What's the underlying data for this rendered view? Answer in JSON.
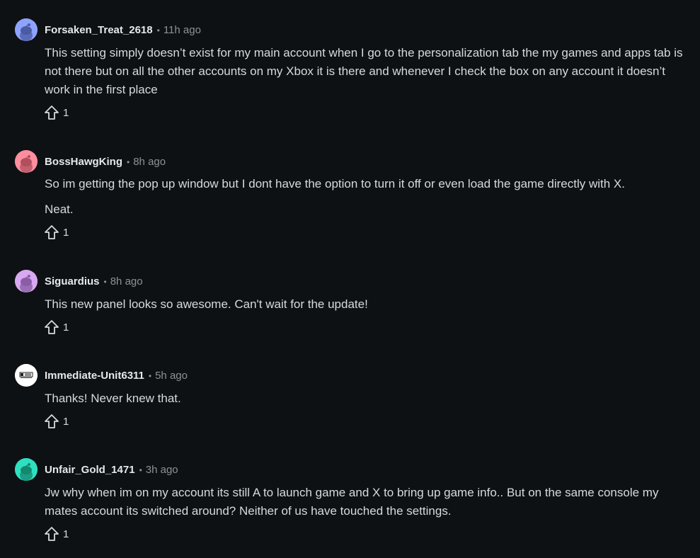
{
  "comments": [
    {
      "author": "Forsaken_Treat_2618",
      "time": "11h ago",
      "paragraphs": [
        "This setting simply doesn’t exist for my main account when I go to the personalization tab the my games and apps tab is not there but on all the other accounts on my Xbox it is there and whenever I check the box on any account it doesn’t work in the first place"
      ],
      "votes": "1",
      "avatar_color": "#8ea2ff"
    },
    {
      "author": "BossHawgKing",
      "time": "8h ago",
      "paragraphs": [
        "So im getting the pop up window but I dont have the option to turn it off or even load the game directly with X.",
        "Neat."
      ],
      "votes": "1",
      "avatar_color": "#ff8e9e"
    },
    {
      "author": "Siguardius",
      "time": "8h ago",
      "paragraphs": [
        "This new panel looks so awesome. Can't wait for the update!"
      ],
      "votes": "1",
      "avatar_color": "#d9a8f2"
    },
    {
      "author": "Immediate-Unit6311",
      "time": "5h ago",
      "paragraphs": [
        "Thanks! Never knew that."
      ],
      "votes": "1",
      "avatar_color": "#ffffff"
    },
    {
      "author": "Unfair_Gold_1471",
      "time": "3h ago",
      "paragraphs": [
        "Jw why when im on my account its still A to launch game and X to bring up game info.. But on the same console my mates account its switched around? Neither of us have touched the settings."
      ],
      "votes": "1",
      "avatar_color": "#2fe0c0"
    }
  ],
  "separator": "•",
  "icons": {
    "avatar": "snoo-avatar-icon",
    "vote": "upvote-arrow-icon"
  }
}
